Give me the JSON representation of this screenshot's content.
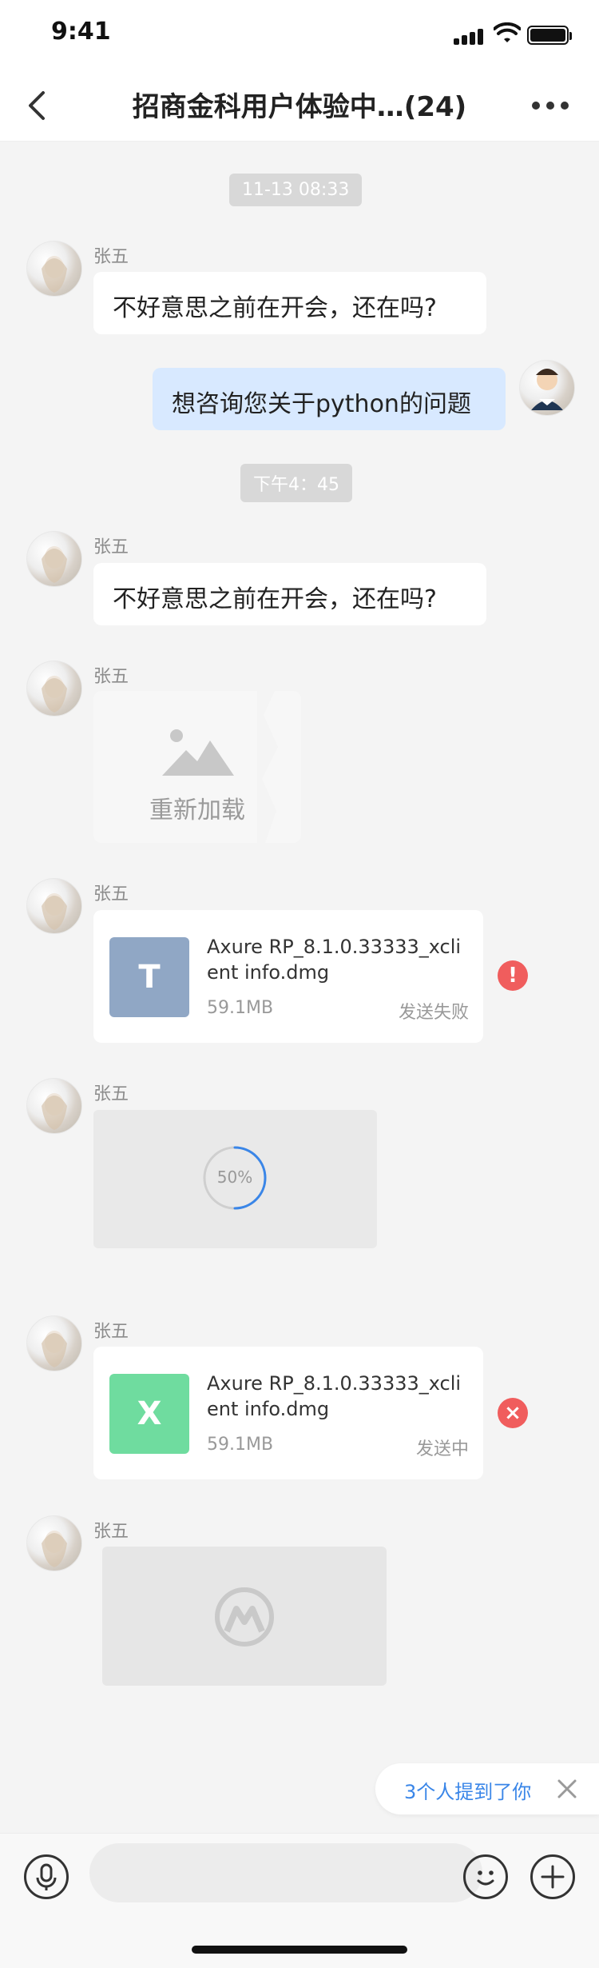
{
  "status_bar": {
    "time": "9:41"
  },
  "header": {
    "title": "招商金科用户体验中…(24)"
  },
  "messages": {
    "timestamps": [
      "11-13  08:33",
      "下午4：45"
    ],
    "user_name": "张五",
    "m1_text": "不好意思之前在开会，还在吗?",
    "m2_text": "想咨询您关于python的问题",
    "m3_text": "不好意思之前在开会，还在吗?",
    "image_reload": "重新加载",
    "file1": {
      "icon_letter": "T",
      "name": "Axure RP_8.1.0.33333_xclient info.dmg",
      "size": "59.1MB",
      "status": "发送失败"
    },
    "video_progress": "50%",
    "file2": {
      "icon_letter": "X",
      "name": "Axure RP_8.1.0.33333_xclient info.dmg",
      "size": "59.1MB",
      "status": "发送中"
    }
  },
  "mention": {
    "text": "3个人提到了你"
  },
  "input": {
    "value": ""
  },
  "colors": {
    "blue_bubble": "#d8e9ff",
    "accent": "#3a86e8",
    "error": "#f05d5d",
    "file1_bg": "#90a7c5",
    "file2_bg": "#6fdc9f"
  }
}
